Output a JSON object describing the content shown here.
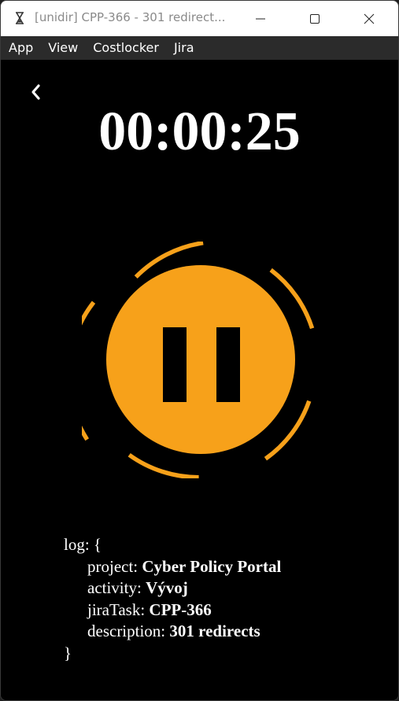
{
  "window": {
    "title": "[unidir] CPP-366 - 301 redirect...",
    "controls": [
      "minimize",
      "maximize",
      "close"
    ]
  },
  "menu": [
    "App",
    "View",
    "Costlocker",
    "Jira"
  ],
  "timer": {
    "display": "00:00:25"
  },
  "colors": {
    "accent": "#f7a11a",
    "background": "#000000",
    "text": "#ffffff",
    "menubar": "#2b2b2b"
  },
  "icons": {
    "app": "hourglass-icon",
    "back": "chevron-left-icon",
    "pause": "pause-icon"
  },
  "log": {
    "open": "log: {",
    "close": "}",
    "fields": [
      {
        "key": "project: ",
        "value": "Cyber Policy Portal"
      },
      {
        "key": "activity: ",
        "value": "Vývoj"
      },
      {
        "key": "jiraTask: ",
        "value": "CPP-366"
      },
      {
        "key": "description: ",
        "value": "301 redirects"
      }
    ]
  }
}
